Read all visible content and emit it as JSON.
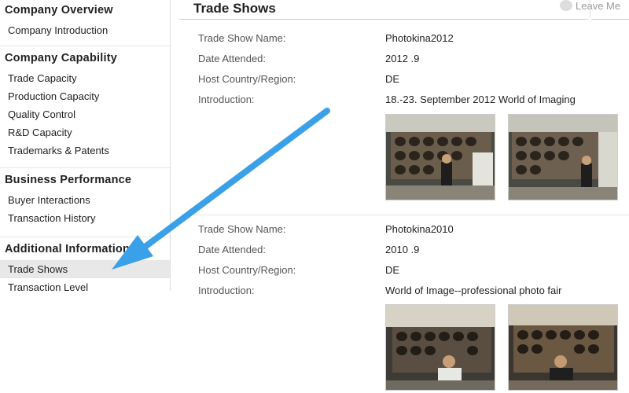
{
  "sidebar": {
    "sections": [
      {
        "title": "Company Overview",
        "items": [
          "Company Introduction"
        ]
      },
      {
        "title": "Company Capability",
        "items": [
          "Trade Capacity",
          "Production Capacity",
          "Quality Control",
          "R&D Capacity",
          "Trademarks & Patents"
        ]
      },
      {
        "title": "Business Performance",
        "items": [
          "Buyer Interactions",
          "Transaction History"
        ]
      },
      {
        "title": "Additional Information",
        "items": [
          "Trade Shows",
          "Transaction Level"
        ]
      }
    ]
  },
  "header": {
    "title": "Trade Shows",
    "leave_message": "Leave Me"
  },
  "labels": {
    "name": "Trade Show Name:",
    "date": "Date Attended:",
    "host": "Host Country/Region:",
    "intro": "Introduction:"
  },
  "shows": [
    {
      "name": "Photokina2012",
      "date": "2012 .9",
      "host": "DE",
      "intro": "18.-23. September 2012 World of Imaging"
    },
    {
      "name": "Photokina2010",
      "date": "2010 .9",
      "host": "DE",
      "intro": "World of Image--professional photo fair"
    }
  ],
  "annotation": {
    "color": "#3aa0e8",
    "points_to": "Trade Shows"
  },
  "colors": {
    "active_item_bg": "#e8e8e8"
  }
}
